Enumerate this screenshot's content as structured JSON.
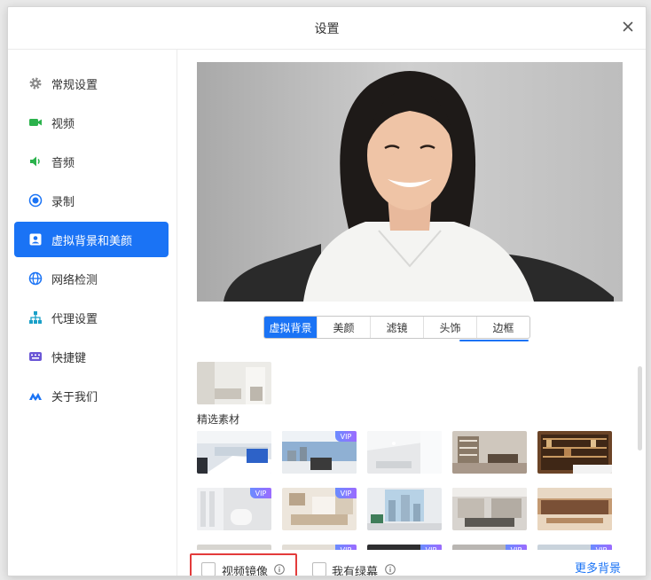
{
  "dialog": {
    "title": "设置"
  },
  "sidebar": {
    "items": [
      {
        "label": "常规设置",
        "icon": "gear-icon"
      },
      {
        "label": "视频",
        "icon": "video-camera-icon"
      },
      {
        "label": "音频",
        "icon": "speaker-icon"
      },
      {
        "label": "录制",
        "icon": "record-icon"
      },
      {
        "label": "虚拟背景和美颜",
        "icon": "portrait-icon",
        "active": true
      },
      {
        "label": "网络检测",
        "icon": "globe-icon"
      },
      {
        "label": "代理设置",
        "icon": "network-tree-icon"
      },
      {
        "label": "快捷键",
        "icon": "keyboard-icon"
      },
      {
        "label": "关于我们",
        "icon": "logo-icon"
      }
    ]
  },
  "tabs": {
    "items": [
      "虚拟背景",
      "美颜",
      "滤镜",
      "头饰",
      "边框"
    ],
    "active": "虚拟背景"
  },
  "backgrounds": {
    "section_label": "精选素材",
    "vip_badge": "VIP"
  },
  "footer": {
    "mirror_label": "视频镜像",
    "green_screen_label": "我有绿幕",
    "more_label": "更多背景"
  },
  "colors": {
    "accent": "#1a73f5",
    "highlight_border": "#e33b3b"
  }
}
